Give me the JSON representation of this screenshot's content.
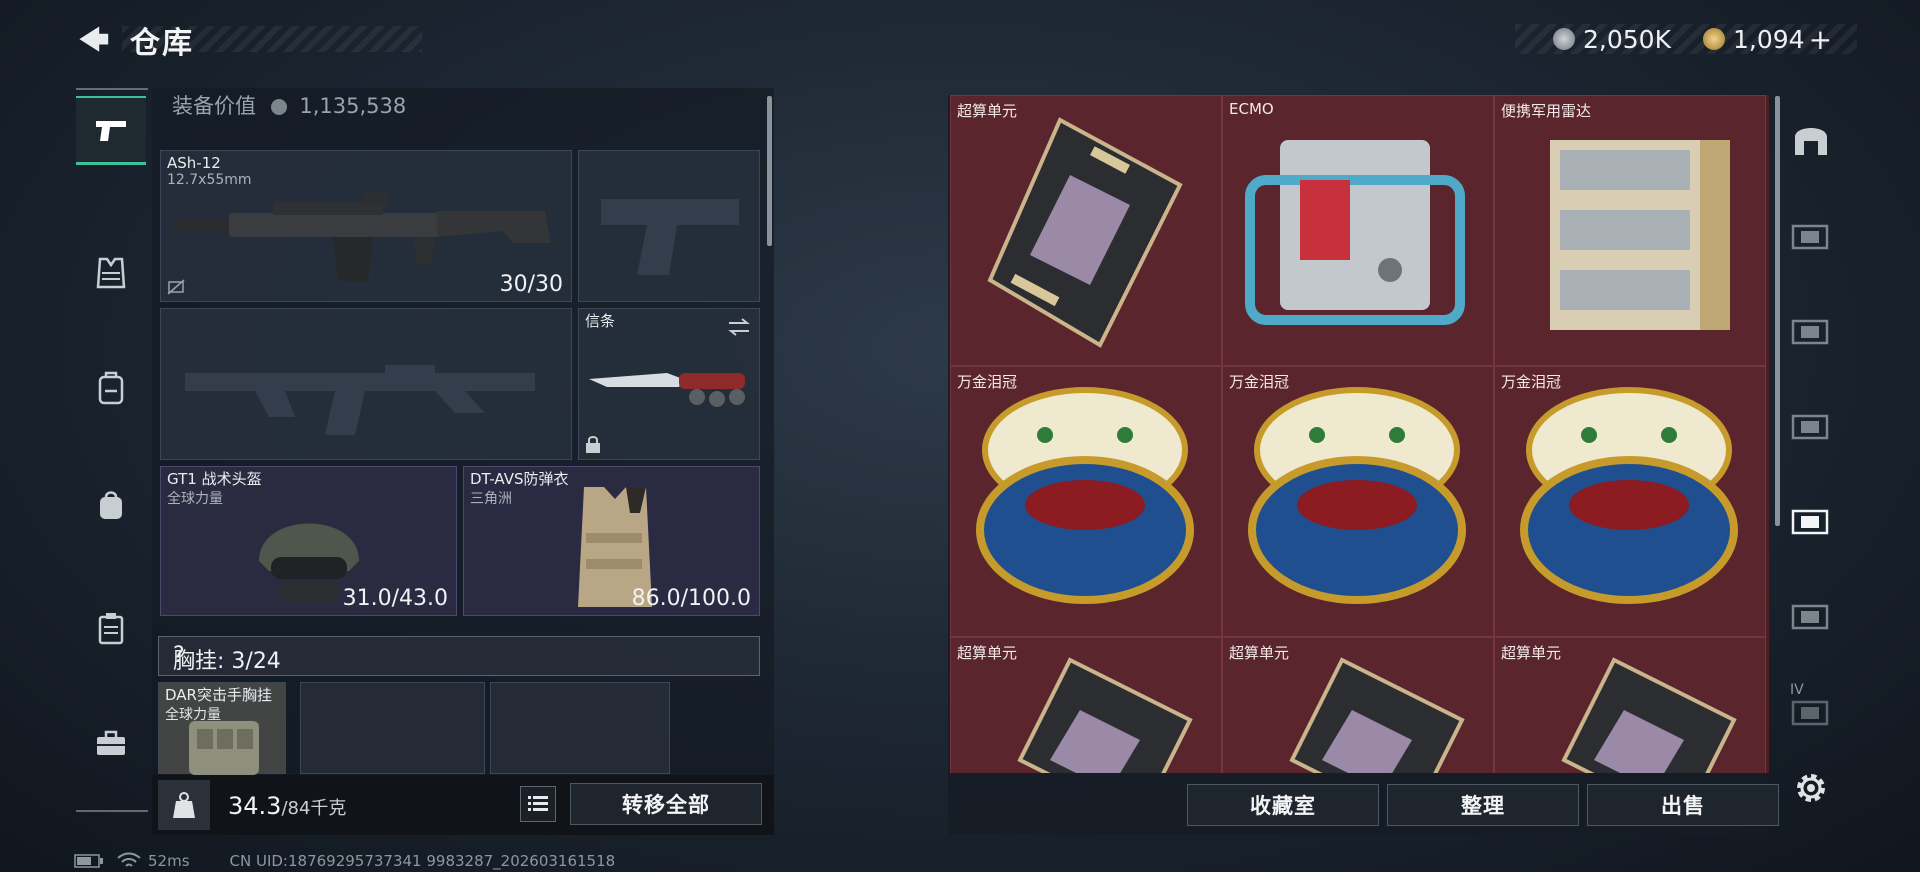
{
  "header": {
    "title": "仓库",
    "currency_a": "2,050K",
    "currency_b": "1,094",
    "currency_b_add": "+"
  },
  "left": {
    "equip_value_label": "装备价值",
    "equip_value": "1,135,538",
    "primary_weapon": {
      "name": "ASh-12",
      "ammo": "12.7x55mm",
      "count": "30/30"
    },
    "melee": {
      "name": "信条"
    },
    "helmet": {
      "name": "GT1 战术头盔",
      "faction": "全球力量",
      "durability": "31.0/43.0"
    },
    "armor": {
      "name": "DT-AVS防弹衣",
      "faction": "三角洲",
      "durability": "86.0/100.0"
    },
    "chest_label": "胸挂: 3/24",
    "chest_help": "?",
    "chest_rig": {
      "name": "DAR突击手胸挂",
      "faction": "全球力量"
    },
    "weight_value": "34.3",
    "weight_max": "/84千克",
    "transfer_all": "转移全部"
  },
  "right": {
    "items": [
      {
        "name": "超算单元",
        "kind": "compute"
      },
      {
        "name": "ECMO",
        "kind": "ecmo"
      },
      {
        "name": "便携军用雷达",
        "kind": "radar"
      },
      {
        "name": "万金泪冠",
        "kind": "egg"
      },
      {
        "name": "万金泪冠",
        "kind": "egg"
      },
      {
        "name": "万金泪冠",
        "kind": "egg"
      },
      {
        "name": "超算单元",
        "kind": "compute"
      },
      {
        "name": "超算单元",
        "kind": "compute"
      },
      {
        "name": "超算单元",
        "kind": "compute"
      }
    ],
    "collection_btn": "收藏室",
    "sort_btn": "整理",
    "sell_btn": "出售",
    "tab_last_label": "IV"
  },
  "status": {
    "ping": "52ms",
    "uid": "CN UID:18769295737341 9983287_202603161518"
  },
  "colors": {
    "accent": "#3fbf9a",
    "item_bg": "#5a252c"
  }
}
